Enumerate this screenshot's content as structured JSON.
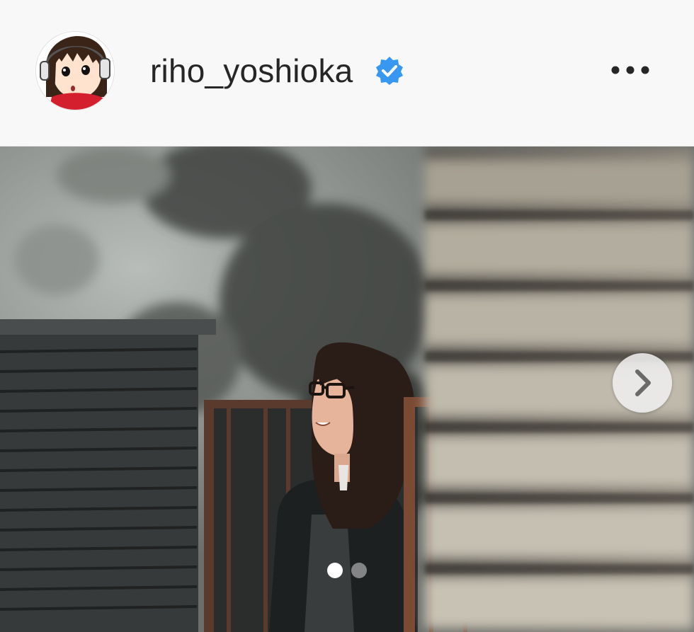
{
  "post": {
    "username": "riho_yoshioka",
    "verified": true,
    "avatar_icon": "cartoon-girl-avatar",
    "more_icon": "ellipsis-icon",
    "next_icon": "chevron-right-icon",
    "carousel": {
      "total_images": 2,
      "current_index": 1
    },
    "colors": {
      "header_bg": "#f8f8f8",
      "username_text": "#262626",
      "verified_badge": "#3897f0"
    }
  }
}
